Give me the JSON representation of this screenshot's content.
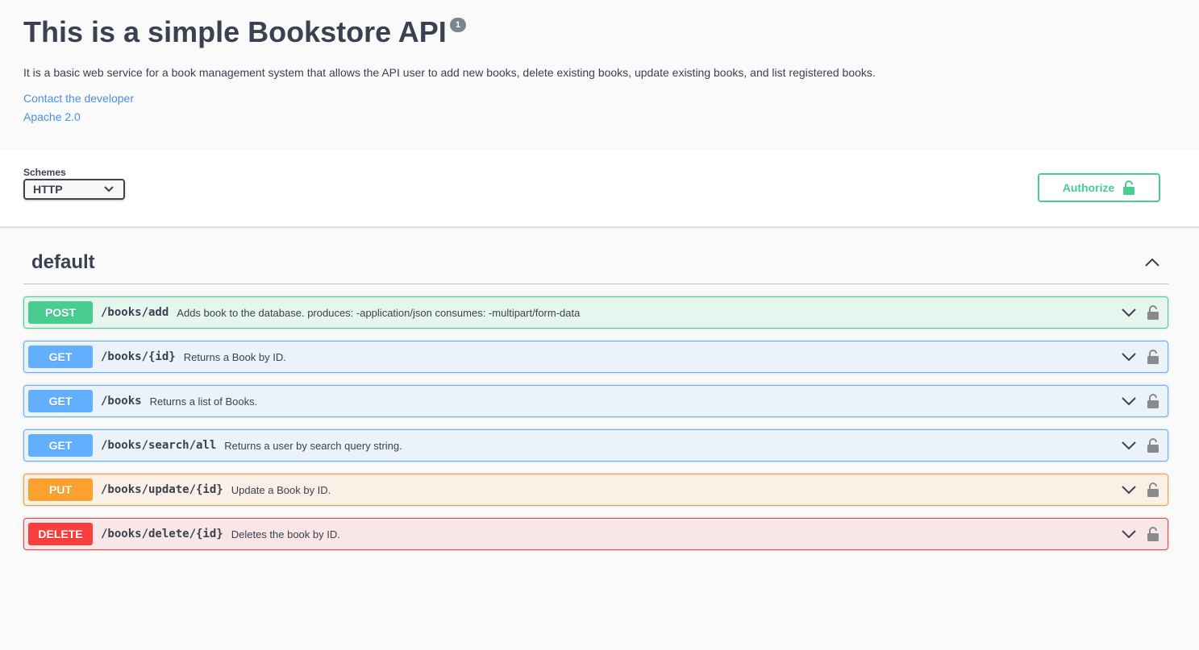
{
  "info": {
    "title": "This is a simple Bookstore API",
    "version": "1",
    "description": "It is a basic web service for a book management system that allows the API user to add new books, delete existing books, update existing books, and list registered books.",
    "contact_link": "Contact the developer",
    "license_link": "Apache 2.0"
  },
  "schemes": {
    "label": "Schemes",
    "selected": "HTTP"
  },
  "authorize": {
    "label": "Authorize"
  },
  "tag": {
    "name": "default"
  },
  "operations": [
    {
      "method": "POST",
      "path": "/books/add",
      "summary": "Adds book to the database. produces: -application/json consumes: -multipart/form-data"
    },
    {
      "method": "GET",
      "path": "/books/{id}",
      "summary": "Returns a Book by ID."
    },
    {
      "method": "GET",
      "path": "/books",
      "summary": "Returns a list of Books."
    },
    {
      "method": "GET",
      "path": "/books/search/all",
      "summary": "Returns a user by search query string."
    },
    {
      "method": "PUT",
      "path": "/books/update/{id}",
      "summary": "Update a Book by ID."
    },
    {
      "method": "DELETE",
      "path": "/books/delete/{id}",
      "summary": "Deletes the book by ID."
    }
  ],
  "colors": {
    "post": "#49cc90",
    "get": "#61affe",
    "put": "#fca130",
    "delete": "#f93e3e",
    "link": "#4990e2"
  },
  "icons": {
    "authorize": "unlock-icon",
    "tag_toggle": "chevron-up-icon",
    "op_toggle": "chevron-down-icon",
    "op_lock": "lock-icon",
    "select_arrow": "chevron-down-icon"
  }
}
